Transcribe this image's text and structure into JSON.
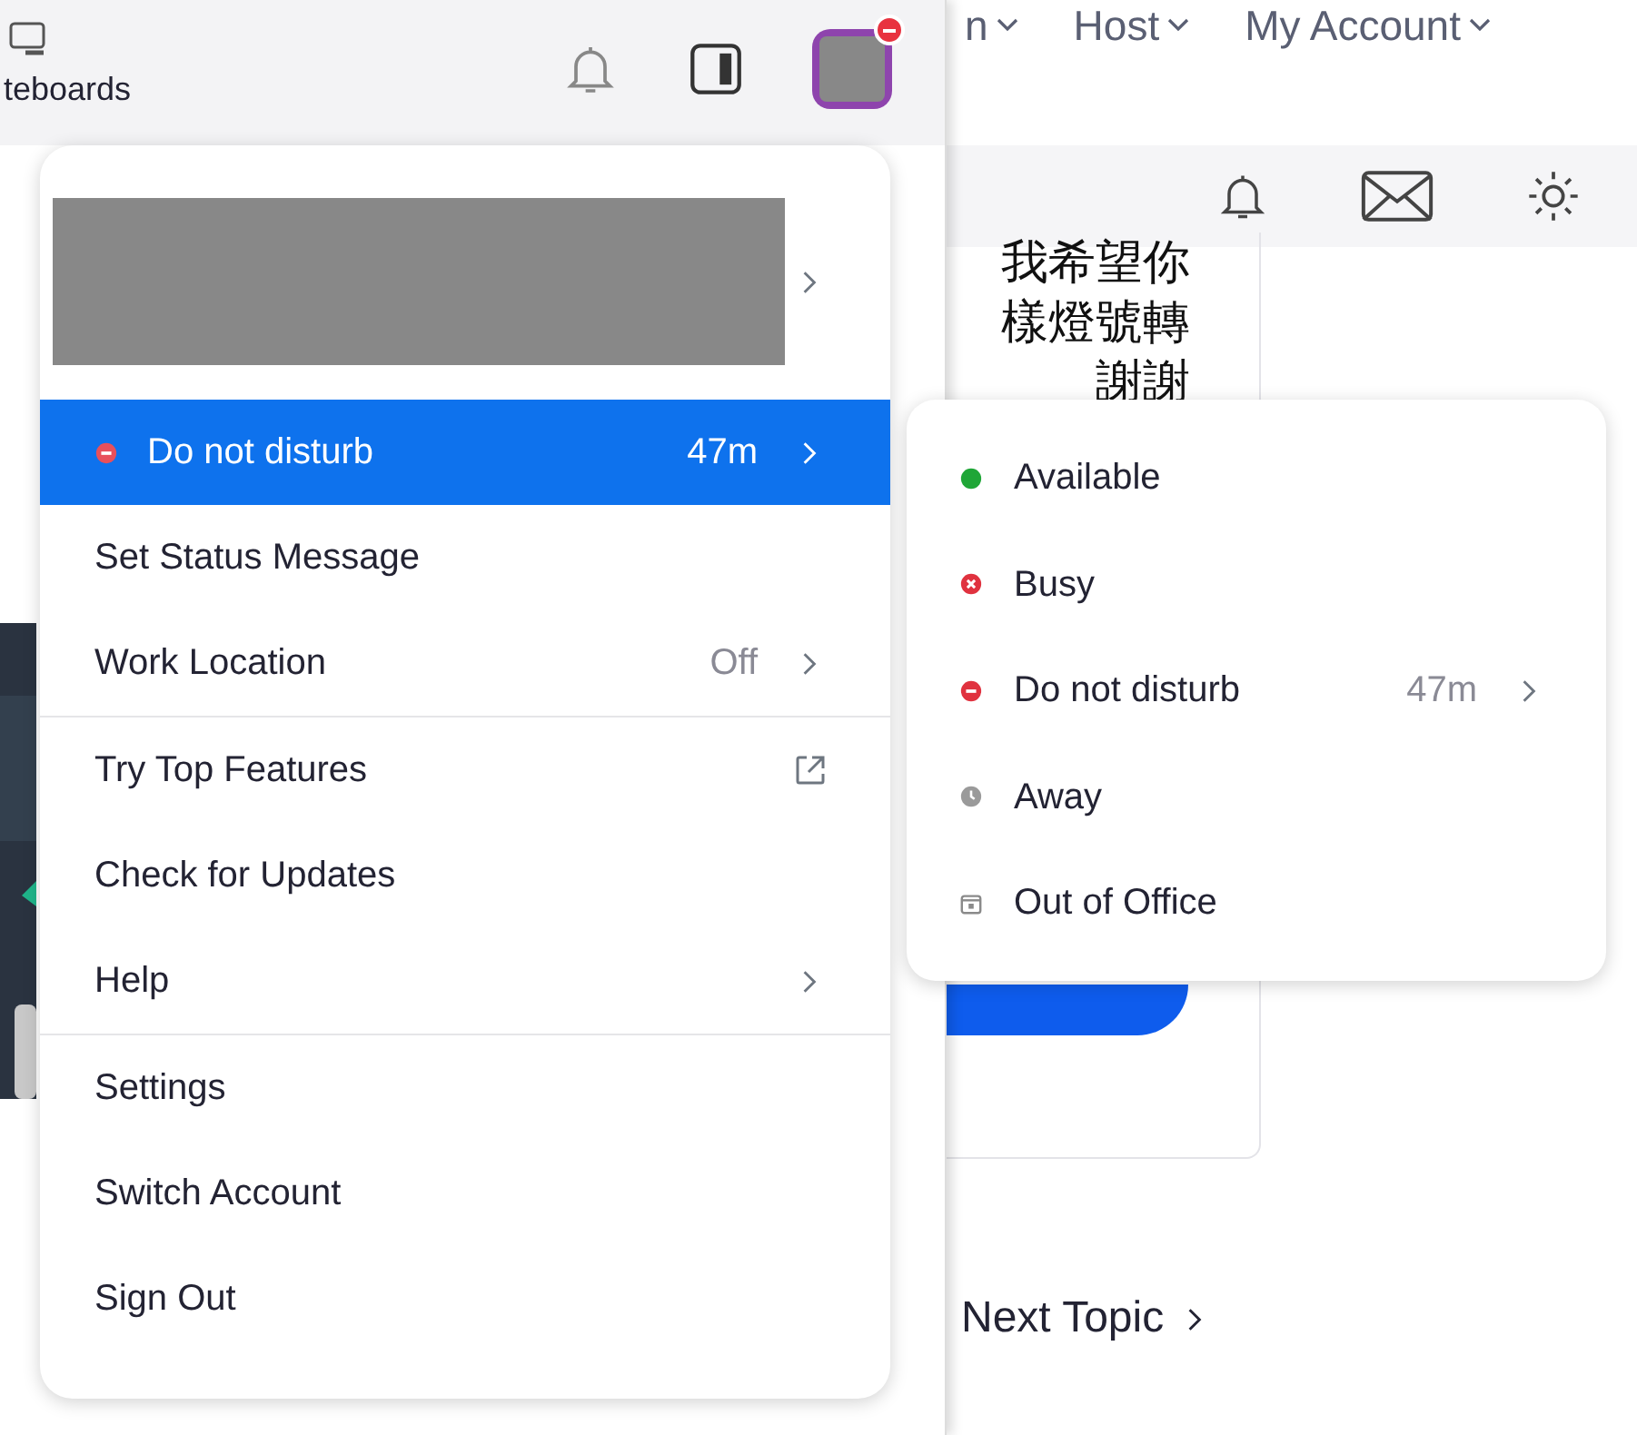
{
  "app_header": {
    "tab_label": "teboards",
    "avatar_badge": true
  },
  "web_nav": [
    "n",
    "Host",
    "My Account"
  ],
  "web_content": {
    "text_lines": [
      "我希望你",
      "樣燈號轉",
      "謝謝"
    ],
    "next_link": "Next Topic"
  },
  "profile_menu": {
    "groups": [
      [
        {
          "label": "Do not disturb",
          "kind": "status",
          "color": "#e8505b",
          "detail": "47m",
          "has_submenu": true,
          "selected": true
        },
        {
          "label": "Set Status Message",
          "kind": "plain",
          "has_submenu": false,
          "selected": false
        },
        {
          "label": "Work Location",
          "kind": "plain",
          "detail": "Off",
          "has_submenu": true,
          "selected": false
        }
      ],
      [
        {
          "label": "Try Top Features",
          "kind": "external",
          "has_submenu": false,
          "selected": false
        },
        {
          "label": "Check for Updates",
          "kind": "plain",
          "has_submenu": false,
          "selected": false
        },
        {
          "label": "Help",
          "kind": "plain",
          "has_submenu": true,
          "selected": false
        }
      ],
      [
        {
          "label": "Settings",
          "kind": "plain",
          "has_submenu": false,
          "selected": false
        },
        {
          "label": "Switch Account",
          "kind": "plain",
          "has_submenu": false,
          "selected": false
        },
        {
          "label": "Sign Out",
          "kind": "plain",
          "has_submenu": false,
          "selected": false
        }
      ]
    ]
  },
  "status_submenu": [
    {
      "label": "Available",
      "kind": "available",
      "color": "#1fa637",
      "has_submenu": false
    },
    {
      "label": "Busy",
      "kind": "busy",
      "color": "#e0323f",
      "has_submenu": false
    },
    {
      "label": "Do not disturb",
      "kind": "dnd",
      "color": "#e0323f",
      "detail": "47m",
      "has_submenu": true
    },
    {
      "label": "Away",
      "kind": "away",
      "color": "#9a9a9a",
      "has_submenu": false
    },
    {
      "label": "Out of Office",
      "kind": "ooo",
      "color": "#8a8a8a",
      "has_submenu": false
    }
  ]
}
